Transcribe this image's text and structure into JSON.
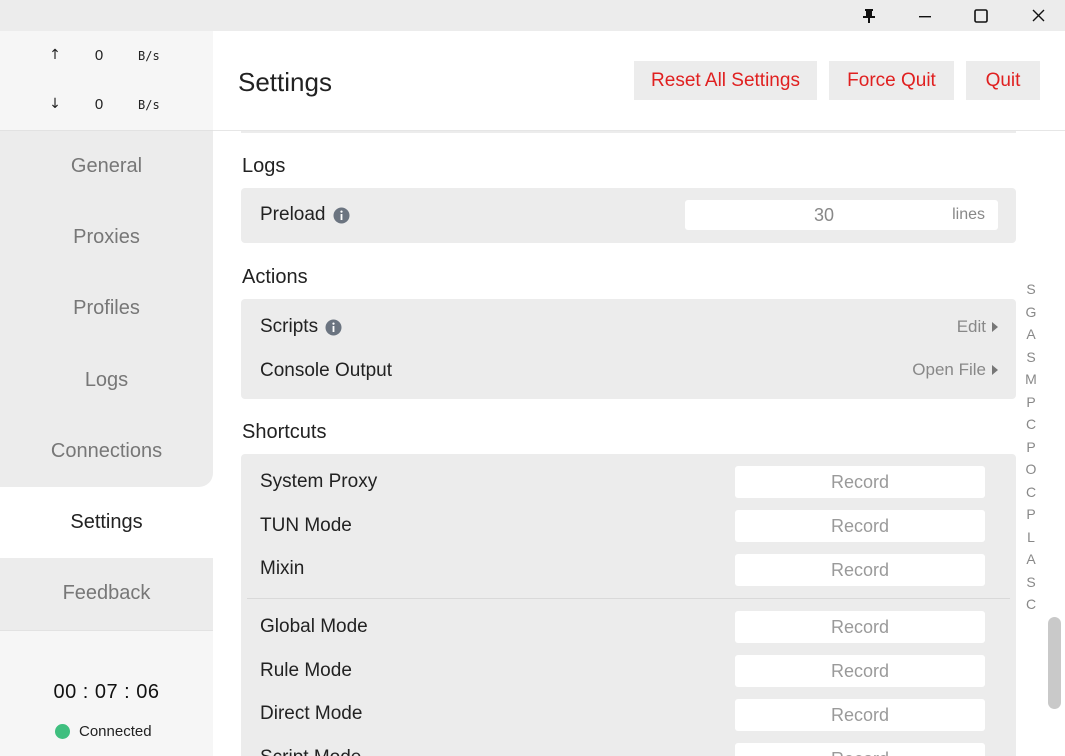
{
  "window": {
    "buttons": [
      "pin",
      "minimize",
      "maximize",
      "close"
    ]
  },
  "traffic": {
    "up": {
      "arrow": "↑",
      "value": "0",
      "unit": "B/s"
    },
    "down": {
      "arrow": "↓",
      "value": "0",
      "unit": "B/s"
    }
  },
  "nav": {
    "items": [
      "General",
      "Proxies",
      "Profiles",
      "Logs",
      "Connections",
      "Settings",
      "Feedback"
    ],
    "active": "Settings"
  },
  "status": {
    "timer": "00 : 07 : 06",
    "connection": "Connected",
    "connection_color": "#3fbf7f"
  },
  "header": {
    "title": "Settings",
    "reset_label": "Reset All Settings",
    "force_quit_label": "Force Quit",
    "quit_label": "Quit",
    "button_text_color": "#e02020"
  },
  "logs": {
    "title": "Logs",
    "preload_label": "Preload",
    "preload_value": "30",
    "preload_unit": "lines"
  },
  "actions": {
    "title": "Actions",
    "scripts_label": "Scripts",
    "scripts_action": "Edit",
    "console_label": "Console Output",
    "console_action": "Open File"
  },
  "shortcuts": {
    "title": "Shortcuts",
    "record_label": "Record",
    "group1": [
      "System Proxy",
      "TUN Mode",
      "Mixin"
    ],
    "group2": [
      "Global Mode",
      "Rule Mode",
      "Direct Mode",
      "Script Mode"
    ]
  },
  "index_letters": [
    "S",
    "G",
    "A",
    "S",
    "M",
    "P",
    "C",
    "P",
    "O",
    "C",
    "P",
    "L",
    "A",
    "S",
    "C"
  ]
}
